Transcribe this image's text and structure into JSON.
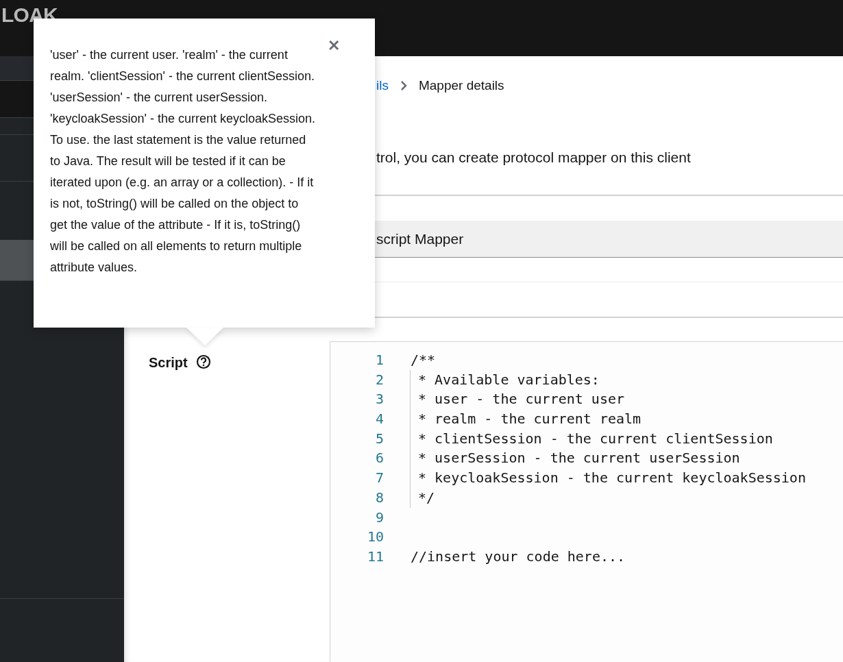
{
  "header": {
    "logo": "LOAK"
  },
  "sidebar": {
    "items": [
      {
        "selected": false
      },
      {
        "selected": false
      },
      {
        "selected": false
      },
      {
        "selected": false
      },
      {
        "selected": true
      }
    ]
  },
  "breadcrumb": [
    {
      "label": "ils",
      "kind": "link"
    },
    {
      "label": "Mapper details",
      "kind": "current"
    }
  ],
  "description": "trol, you can create protocol mapper on this client",
  "mapper_type": {
    "value": "script Mapper"
  },
  "script_field": {
    "label": "Script",
    "code_lines": [
      {
        "number": "1",
        "text": "/**",
        "guide": false
      },
      {
        "number": "2",
        "text": " * Available variables:",
        "guide": true
      },
      {
        "number": "3",
        "text": " * user - the current user",
        "guide": true
      },
      {
        "number": "4",
        "text": " * realm - the current realm",
        "guide": true
      },
      {
        "number": "5",
        "text": " * clientSession - the current clientSession",
        "guide": true
      },
      {
        "number": "6",
        "text": " * userSession - the current userSession",
        "guide": true
      },
      {
        "number": "7",
        "text": " * keycloakSession - the current keycloakSession",
        "guide": true
      },
      {
        "number": "8",
        "text": " */",
        "guide": true
      },
      {
        "number": "9",
        "guide": false
      },
      {
        "number": "10",
        "guide": false
      },
      {
        "number": "11",
        "text": "//insert your code here...",
        "guide": false
      }
    ]
  },
  "popover": {
    "text": "'user' - the current user. 'realm' - the current realm. 'clientSession' - the current clientSession. 'userSession' - the current userSession. 'keycloakSession' - the current keycloakSession. To use. the last statement is the value returned to Java. The result will be tested if it can be iterated upon (e.g. an array or a collection). - If it is not, toString() will be called on the object to get the value of the attribute - If it is, toString() will be called on all elements to return multiple attribute values.",
    "close": "✕"
  }
}
